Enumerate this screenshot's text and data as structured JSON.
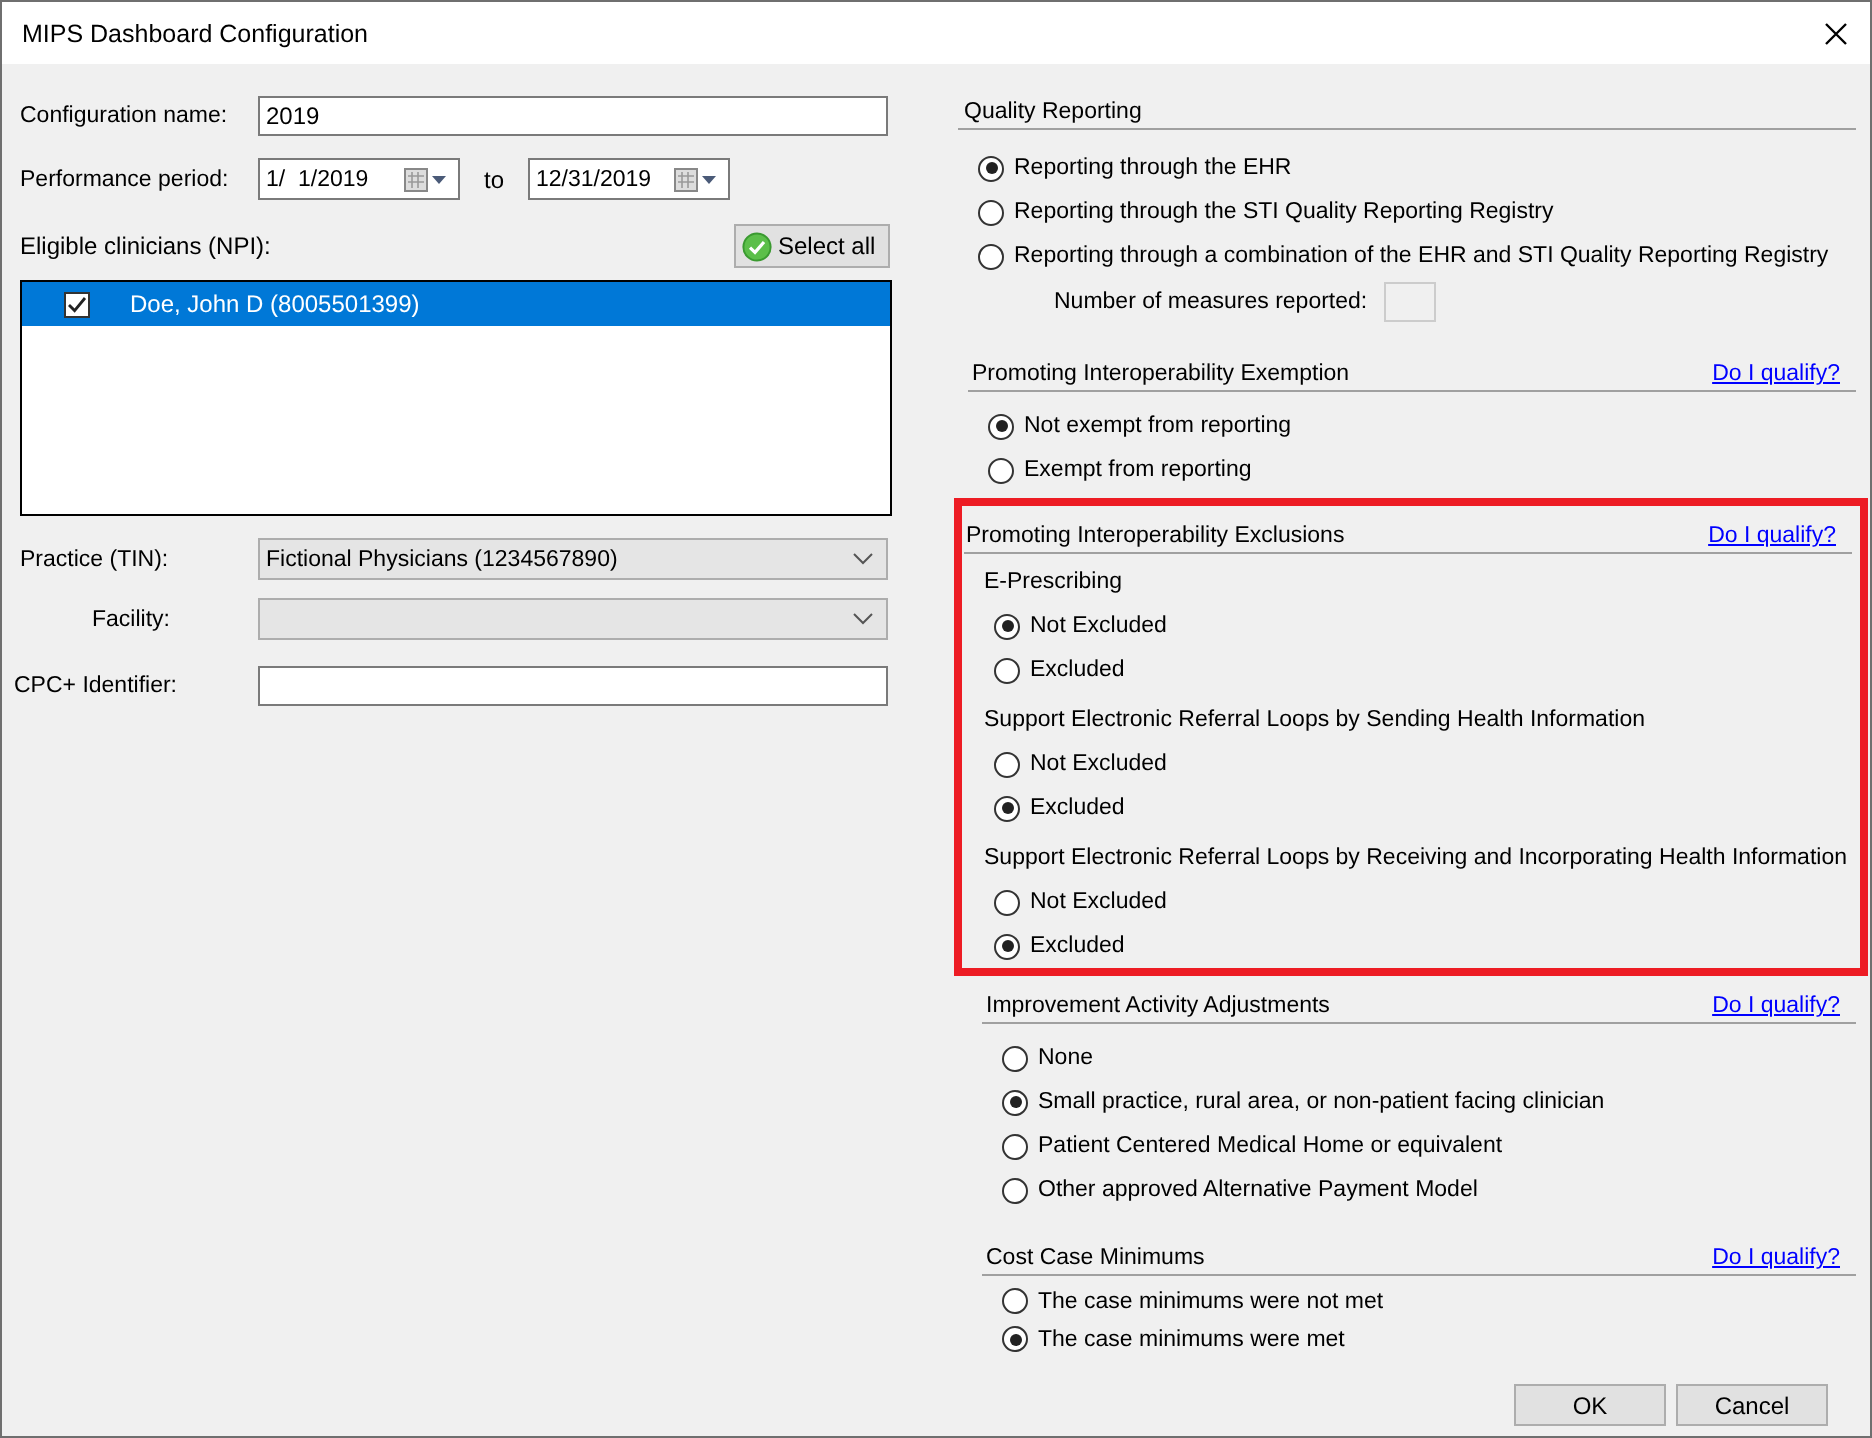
{
  "window": {
    "title": "MIPS Dashboard Configuration"
  },
  "left": {
    "config_name": {
      "label": "Configuration name:",
      "value": "2019"
    },
    "period": {
      "label": "Performance period:",
      "from": "1/  1/2019",
      "to_label": "to",
      "to": "12/31/2019"
    },
    "clinicians": {
      "label": "Eligible clinicians (NPI):",
      "select_all": "Select all",
      "items": [
        {
          "label": "Doe, John D (8005501399)",
          "checked": true,
          "selected": true
        }
      ]
    },
    "practice": {
      "label": "Practice (TIN):",
      "value": "Fictional Physicians (1234567890)"
    },
    "facility": {
      "label": "Facility:"
    },
    "cpc": {
      "label": "CPC+ Identifier:"
    }
  },
  "sections": [
    {
      "title": "Quality Reporting",
      "highlighted": false,
      "groups": [
        {
          "options": [
            {
              "label": "Reporting through the EHR",
              "selected": true
            },
            {
              "label": "Reporting through the STI Quality Reporting Registry",
              "selected": false
            },
            {
              "label": "Reporting through a combination of the EHR and STI Quality Reporting Registry",
              "selected": false
            }
          ]
        }
      ],
      "measures_label": "Number of measures reported:"
    },
    {
      "title": "Promoting Interoperability Exemption",
      "link": "Do I qualify?",
      "highlighted": false,
      "groups": [
        {
          "options": [
            {
              "label": "Not exempt from reporting",
              "selected": true
            },
            {
              "label": "Exempt from reporting",
              "selected": false
            }
          ]
        }
      ]
    },
    {
      "title": "Promoting Interoperability Exclusions",
      "link": "Do I qualify?",
      "highlighted": true,
      "groups": [
        {
          "heading": "E-Prescribing",
          "options": [
            {
              "label": "Not Excluded",
              "selected": true
            },
            {
              "label": "Excluded",
              "selected": false
            }
          ]
        },
        {
          "heading": "Support Electronic Referral Loops by Sending Health Information",
          "options": [
            {
              "label": "Not Excluded",
              "selected": false
            },
            {
              "label": "Excluded",
              "selected": true
            }
          ]
        },
        {
          "heading": "Support Electronic Referral Loops by Receiving and Incorporating Health Information",
          "options": [
            {
              "label": "Not Excluded",
              "selected": false
            },
            {
              "label": "Excluded",
              "selected": true
            }
          ]
        }
      ]
    },
    {
      "title": "Improvement Activity Adjustments",
      "link": "Do I qualify?",
      "highlighted": false,
      "groups": [
        {
          "options": [
            {
              "label": "None",
              "selected": false
            },
            {
              "label": "Small practice, rural area, or non-patient facing clinician",
              "selected": true
            },
            {
              "label": "Patient Centered Medical Home or equivalent",
              "selected": false
            },
            {
              "label": "Other approved Alternative Payment Model",
              "selected": false
            }
          ]
        }
      ]
    },
    {
      "title": "Cost Case Minimums",
      "link": "Do I qualify?",
      "highlighted": false,
      "groups": [
        {
          "options": [
            {
              "label": "The case minimums were not met",
              "selected": false
            },
            {
              "label": "The case minimums were met",
              "selected": true
            }
          ]
        }
      ]
    }
  ],
  "buttons": [
    "OK",
    "Cancel"
  ]
}
